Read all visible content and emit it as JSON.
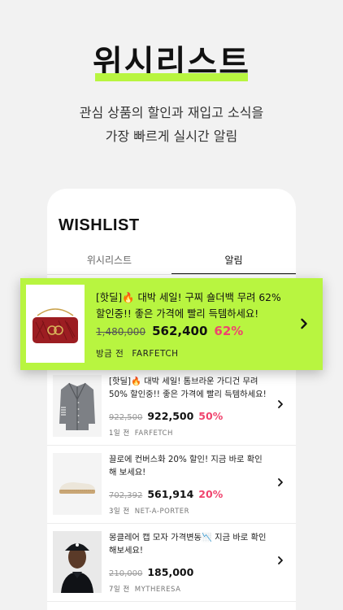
{
  "hero": {
    "title": "위시리스트",
    "subtitle_line1": "관심 상품의 할인과 재입고 소식을",
    "subtitle_line2": "가장 빠르게 실시간 알림"
  },
  "app": {
    "header": "WISHLIST",
    "tabs": [
      {
        "label": "위시리스트",
        "active": false
      },
      {
        "label": "알림",
        "active": true
      }
    ]
  },
  "colors": {
    "accent": "#b8f540",
    "discount": "#f0446e"
  },
  "highlight_item": {
    "text": "[핫딜]🔥 대박 세일! 구찌 숄더백 무려 62% 할인중!! 좋은 가격에 빨리 득템하세요!",
    "old_price": "1,480,000",
    "new_price": "562,400",
    "discount": "62%",
    "time": "방금 전",
    "shop": "FARFETCH",
    "icon": "chevron-right-icon"
  },
  "items": [
    {
      "text": "[핫딜]🔥 대박 세일! 톰브라운 가디건 무려 50% 할인중!! 좋은 가격에 빨리 득템하세요!",
      "old_price": "922,500",
      "new_price": "922,500",
      "discount": "50%",
      "time": "1일 전",
      "shop": "FARFETCH",
      "image": "cardigan"
    },
    {
      "text": "끌로에 컨버스화 20% 할인! 지금 바로 확인해 보세요!",
      "old_price": "702,392",
      "new_price": "561,914",
      "discount": "20%",
      "time": "3일 전",
      "shop": "NET-A-PORTER",
      "image": "espadrille"
    },
    {
      "text": "몽클레어 캡 모자 가격변동📉 지금 바로 확인해보세요!",
      "old_price": "210,000",
      "new_price": "185,000",
      "discount": "",
      "time": "7일 전",
      "shop": "MYTHERESA",
      "image": "cap-model"
    }
  ]
}
